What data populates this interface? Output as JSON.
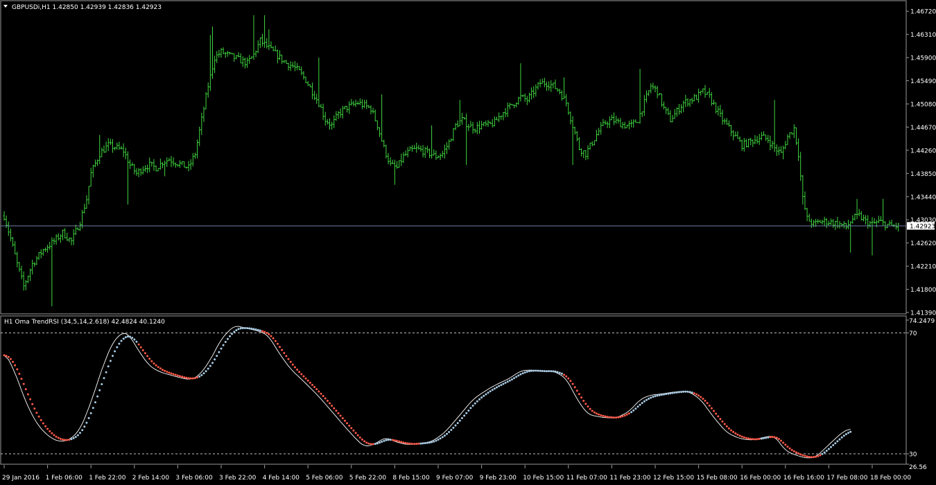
{
  "price_panel": {
    "symbol_line": "GBPUSDi,H1  1.42850 1.42939 1.42836 1.42923",
    "price_ticks": [
      "1.46720",
      "1.46310",
      "1.45900",
      "1.45490",
      "1.45080",
      "1.44670",
      "1.44260",
      "1.43850",
      "1.43440",
      "1.43030",
      "1.42620",
      "1.42210",
      "1.41800",
      "1.41390"
    ],
    "current_price": "1.42923",
    "colors": {
      "bars": "#3fd73f",
      "price_line": "#6f7fa8",
      "bid_label_bg": "#ffffff",
      "bid_label_text": "#000000"
    }
  },
  "indicator_panel": {
    "title": "H1 Oma TrendRSI (34,5,14,2.618) 42.4824 40.1240",
    "scale_max": "74.2479",
    "scale_min": "26.56",
    "level_high": "70",
    "level_low": "30",
    "colors": {
      "rsi_line": "#ffffff",
      "dots_up": "#a9cbe3",
      "dots_down": "#ff5a4a",
      "levels": "#c0c0c0"
    }
  },
  "time_axis": {
    "labels": [
      "29 Jan 2016",
      "1 Feb 06:00",
      "1 Feb 22:00",
      "2 Feb 14:00",
      "3 Feb 06:00",
      "3 Feb 22:00",
      "4 Feb 14:00",
      "5 Feb 06:00",
      "5 Feb 22:00",
      "8 Feb 15:00",
      "9 Feb 07:00",
      "9 Feb 23:00",
      "10 Feb 15:00",
      "11 Feb 07:00",
      "11 Feb 23:00",
      "12 Feb 15:00",
      "15 Feb 08:00",
      "16 Feb 00:00",
      "16 Feb 16:00",
      "17 Feb 08:00",
      "18 Feb 00:00"
    ]
  },
  "chart_data": [
    {
      "type": "candlestick-bars",
      "symbol": "GBPUSDi",
      "timeframe": "H1",
      "ylim": [
        1.4139,
        1.4687
      ],
      "bid": 1.42923,
      "anchors_close": [
        [
          0,
          1.431
        ],
        [
          3,
          1.427
        ],
        [
          6,
          1.4225
        ],
        [
          9,
          1.4185
        ],
        [
          13,
          1.4225
        ],
        [
          18,
          1.425
        ],
        [
          23,
          1.4265
        ],
        [
          27,
          1.428
        ],
        [
          31,
          1.4265
        ],
        [
          35,
          1.43
        ],
        [
          38,
          1.434
        ],
        [
          40,
          1.4385
        ],
        [
          44,
          1.442
        ],
        [
          48,
          1.4435
        ],
        [
          52,
          1.443
        ],
        [
          55,
          1.4425
        ],
        [
          58,
          1.44
        ],
        [
          61,
          1.4385
        ],
        [
          64,
          1.4395
        ],
        [
          67,
          1.44
        ],
        [
          70,
          1.4395
        ],
        [
          73,
          1.4405
        ],
        [
          76,
          1.441
        ],
        [
          79,
          1.4405
        ],
        [
          82,
          1.44
        ],
        [
          85,
          1.4395
        ],
        [
          88,
          1.442
        ],
        [
          91,
          1.448
        ],
        [
          94,
          1.454
        ],
        [
          97,
          1.459
        ],
        [
          100,
          1.46
        ],
        [
          103,
          1.4595
        ],
        [
          106,
          1.459
        ],
        [
          109,
          1.4585
        ],
        [
          112,
          1.458
        ],
        [
          115,
          1.4595
        ],
        [
          118,
          1.462
        ],
        [
          121,
          1.461
        ],
        [
          124,
          1.46
        ],
        [
          127,
          1.459
        ],
        [
          130,
          1.458
        ],
        [
          133,
          1.4575
        ],
        [
          136,
          1.4565
        ],
        [
          139,
          1.455
        ],
        [
          142,
          1.453
        ],
        [
          145,
          1.451
        ],
        [
          148,
          1.448
        ],
        [
          151,
          1.447
        ],
        [
          154,
          1.449
        ],
        [
          157,
          1.45
        ],
        [
          160,
          1.4505
        ],
        [
          163,
          1.451
        ],
        [
          166,
          1.4505
        ],
        [
          169,
          1.45
        ],
        [
          172,
          1.447
        ],
        [
          175,
          1.443
        ],
        [
          178,
          1.44
        ],
        [
          181,
          1.4395
        ],
        [
          184,
          1.4415
        ],
        [
          187,
          1.4425
        ],
        [
          190,
          1.4428
        ],
        [
          193,
          1.4425
        ],
        [
          196,
          1.442
        ],
        [
          199,
          1.4415
        ],
        [
          202,
          1.442
        ],
        [
          205,
          1.444
        ],
        [
          208,
          1.447
        ],
        [
          211,
          1.448
        ],
        [
          214,
          1.447
        ],
        [
          217,
          1.4465
        ],
        [
          220,
          1.447
        ],
        [
          223,
          1.447
        ],
        [
          226,
          1.4475
        ],
        [
          229,
          1.449
        ],
        [
          232,
          1.45
        ],
        [
          235,
          1.451
        ],
        [
          238,
          1.452
        ],
        [
          241,
          1.4515
        ],
        [
          244,
          1.453
        ],
        [
          247,
          1.4545
        ],
        [
          250,
          1.4545
        ],
        [
          253,
          1.454
        ],
        [
          256,
          1.453
        ],
        [
          259,
          1.451
        ],
        [
          262,
          1.447
        ],
        [
          265,
          1.443
        ],
        [
          268,
          1.442
        ],
        [
          271,
          1.444
        ],
        [
          274,
          1.446
        ],
        [
          277,
          1.4475
        ],
        [
          280,
          1.448
        ],
        [
          283,
          1.4475
        ],
        [
          286,
          1.447
        ],
        [
          289,
          1.447
        ],
        [
          292,
          1.448
        ],
        [
          295,
          1.451
        ],
        [
          298,
          1.454
        ],
        [
          301,
          1.453
        ],
        [
          304,
          1.45
        ],
        [
          307,
          1.448
        ],
        [
          310,
          1.4495
        ],
        [
          313,
          1.451
        ],
        [
          316,
          1.4515
        ],
        [
          319,
          1.452
        ],
        [
          322,
          1.453
        ],
        [
          325,
          1.452
        ],
        [
          328,
          1.45
        ],
        [
          331,
          1.448
        ],
        [
          334,
          1.4465
        ],
        [
          337,
          1.445
        ],
        [
          340,
          1.4435
        ],
        [
          343,
          1.444
        ],
        [
          346,
          1.4445
        ],
        [
          349,
          1.445
        ],
        [
          352,
          1.4445
        ],
        [
          355,
          1.443
        ],
        [
          358,
          1.442
        ],
        [
          361,
          1.445
        ],
        [
          364,
          1.4465
        ],
        [
          366,
          1.442
        ],
        [
          368,
          1.434
        ],
        [
          370,
          1.4305
        ],
        [
          373,
          1.4295
        ],
        [
          376,
          1.43
        ],
        [
          379,
          1.43
        ],
        [
          382,
          1.4298
        ],
        [
          385,
          1.4295
        ],
        [
          388,
          1.429
        ],
        [
          391,
          1.4305
        ],
        [
          394,
          1.431
        ],
        [
          397,
          1.43
        ],
        [
          400,
          1.4295
        ],
        [
          403,
          1.43
        ],
        [
          406,
          1.4295
        ],
        [
          409,
          1.4292
        ],
        [
          412,
          1.4292
        ]
      ],
      "spikes": [
        [
          22,
          1.415
        ],
        [
          44,
          1.4453
        ],
        [
          57,
          1.433
        ],
        [
          74,
          1.438
        ],
        [
          95,
          1.463
        ],
        [
          96,
          1.4645
        ],
        [
          115,
          1.4665
        ],
        [
          120,
          1.4665
        ],
        [
          122,
          1.464
        ],
        [
          145,
          1.459
        ],
        [
          174,
          1.4525
        ],
        [
          180,
          1.4365
        ],
        [
          183,
          1.442
        ],
        [
          197,
          1.447
        ],
        [
          210,
          1.4515
        ],
        [
          213,
          1.44
        ],
        [
          236,
          1.4505
        ],
        [
          238,
          1.458
        ],
        [
          258,
          1.4555
        ],
        [
          262,
          1.44
        ],
        [
          293,
          1.457
        ],
        [
          301,
          1.454
        ],
        [
          355,
          1.4515
        ],
        [
          359,
          1.441
        ],
        [
          368,
          1.433
        ],
        [
          383,
          1.4285
        ],
        [
          390,
          1.4245
        ],
        [
          393,
          1.434
        ],
        [
          400,
          1.424
        ],
        [
          405,
          1.434
        ]
      ]
    },
    {
      "type": "line",
      "title": "H1 Oma TrendRSI (34,5,14,2.618)",
      "ylim": [
        26.56,
        74.2479
      ],
      "levels": [
        30,
        70
      ],
      "last_values": [
        42.4824,
        40.124
      ],
      "rsi_anchors": [
        [
          0,
          64
        ],
        [
          5,
          57
        ],
        [
          10,
          47
        ],
        [
          15,
          40
        ],
        [
          20,
          36
        ],
        [
          25,
          34
        ],
        [
          30,
          34.5
        ],
        [
          35,
          38
        ],
        [
          40,
          47
        ],
        [
          45,
          58
        ],
        [
          50,
          67
        ],
        [
          55,
          70.5
        ],
        [
          58,
          69
        ],
        [
          62,
          64
        ],
        [
          67,
          59
        ],
        [
          72,
          57
        ],
        [
          77,
          56
        ],
        [
          82,
          55
        ],
        [
          86,
          54.5
        ],
        [
          90,
          56
        ],
        [
          95,
          61
        ],
        [
          100,
          68
        ],
        [
          106,
          72.5
        ],
        [
          112,
          71.5
        ],
        [
          118,
          70.5
        ],
        [
          122,
          69
        ],
        [
          126,
          64
        ],
        [
          132,
          58
        ],
        [
          138,
          54
        ],
        [
          145,
          49
        ],
        [
          151,
          44
        ],
        [
          157,
          39
        ],
        [
          162,
          35
        ],
        [
          166,
          32.3
        ],
        [
          170,
          33
        ],
        [
          176,
          35.5
        ],
        [
          180,
          34
        ],
        [
          186,
          33
        ],
        [
          192,
          33.5
        ],
        [
          197,
          34
        ],
        [
          203,
          37
        ],
        [
          209,
          42
        ],
        [
          216,
          48
        ],
        [
          222,
          51
        ],
        [
          227,
          53
        ],
        [
          233,
          55
        ],
        [
          238,
          57.5
        ],
        [
          243,
          57.8
        ],
        [
          248,
          57.2
        ],
        [
          253,
          57.5
        ],
        [
          259,
          55
        ],
        [
          264,
          48
        ],
        [
          269,
          43
        ],
        [
          276,
          42
        ],
        [
          282,
          41.8
        ],
        [
          288,
          44
        ],
        [
          293,
          48
        ],
        [
          298,
          49.5
        ],
        [
          303,
          49.8
        ],
        [
          309,
          50.5
        ],
        [
          315,
          50.8
        ],
        [
          321,
          48
        ],
        [
          327,
          42
        ],
        [
          333,
          37
        ],
        [
          339,
          35
        ],
        [
          345,
          34.5
        ],
        [
          350,
          35.5
        ],
        [
          355,
          36
        ],
        [
          360,
          31
        ],
        [
          365,
          29.5
        ],
        [
          370,
          28.5
        ],
        [
          374,
          28.9
        ],
        [
          380,
          33
        ],
        [
          386,
          37
        ],
        [
          390,
          38.5
        ]
      ],
      "signal_segments": [
        {
          "state": "down",
          "from_bar": 0,
          "to_bar": 30
        },
        {
          "state": "up",
          "from_bar": 31,
          "to_bar": 61
        },
        {
          "state": "down",
          "from_bar": 62,
          "to_bar": 89
        },
        {
          "state": "up",
          "from_bar": 90,
          "to_bar": 118
        },
        {
          "state": "down",
          "from_bar": 119,
          "to_bar": 170
        },
        {
          "state": "up",
          "from_bar": 171,
          "to_bar": 178
        },
        {
          "state": "down",
          "from_bar": 179,
          "to_bar": 191
        },
        {
          "state": "up",
          "from_bar": 192,
          "to_bar": 257
        },
        {
          "state": "down",
          "from_bar": 258,
          "to_bar": 288
        },
        {
          "state": "up",
          "from_bar": 289,
          "to_bar": 317
        },
        {
          "state": "down",
          "from_bar": 318,
          "to_bar": 348
        },
        {
          "state": "up",
          "from_bar": 349,
          "to_bar": 352
        },
        {
          "state": "down",
          "from_bar": 353,
          "to_bar": 376
        },
        {
          "state": "up",
          "from_bar": 377,
          "to_bar": 390
        }
      ]
    }
  ]
}
